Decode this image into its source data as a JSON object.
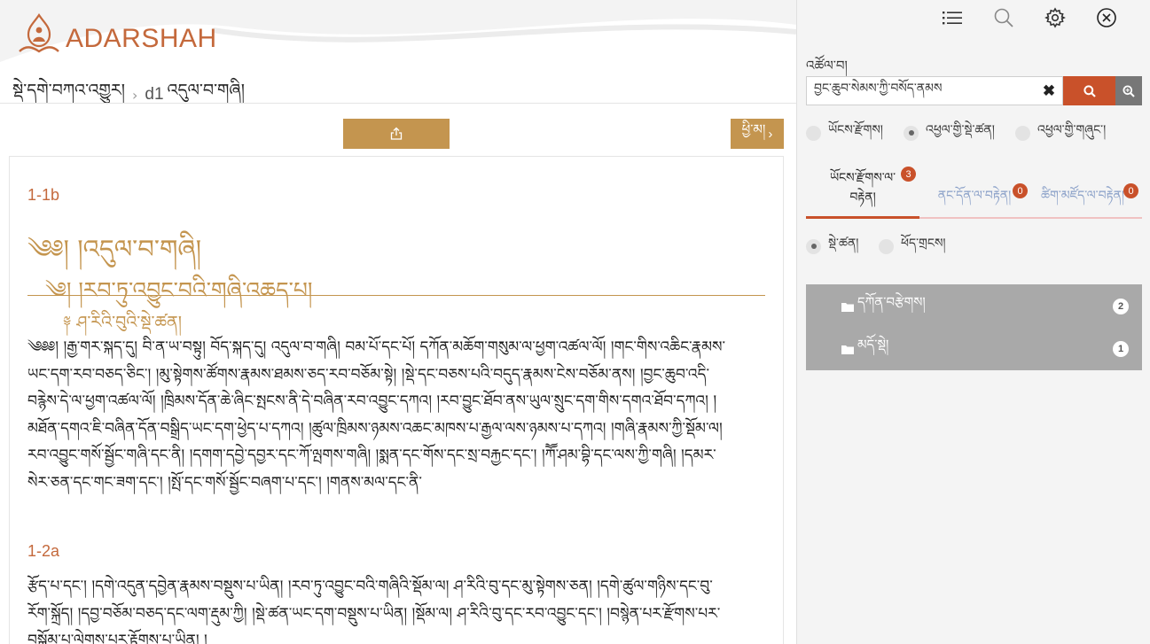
{
  "brand": {
    "name": "ADARSHAH",
    "color": "#c4693c"
  },
  "breadcrumb": {
    "collection": "སྡེ་དགེ་བཀའ་འགྱུར།",
    "separator": "›",
    "code": "d1",
    "title": "འདུལ་བ་གཞི།"
  },
  "toolbar": {
    "share_icon": "share-icon",
    "next_label": "ཕྱི་མ།",
    "next_chevron": "›"
  },
  "content": {
    "sections": [
      {
        "page_ref": "1-1b",
        "heading1": "༄༅། །འདུལ་བ་གཞི།",
        "heading2": "༄། །རབ་ཏུ་འབྱུང་བའི་གཞི་འཆད་པ།",
        "heading3": "༈ ཤ་རིའི་བུའི་སྡེ་ཚན།",
        "lines": [
          "༄༅༅། །རྒྱ་གར་སྐད་དུ། བི་ན་ཡ་བསྟུ། བོད་སྐད་དུ། འདུལ་བ་གཞི། བམ་པོ་དང་པོ། དཀོན་མཆོག་གསུམ་ལ་ཕྱག་འཚལ་ལོ། །གང་གིས་འཆིང་རྣམས་",
          "ཡང་དག་རབ་བཅད་ཅིང་། །མུ་སྟེགས་ཚོགས་རྣམས་ཐམས་ཅད་རབ་བཅོམ་སྟེ། །སྡེ་དང་བཅས་པའི་བདུད་རྣམས་ངེས་བཅོམ་ནས། །བྱང་ཆུབ་འདི་",
          "བརྙེས་དེ་ལ་ཕྱག་འཚལ་ལོ། །ཁྲིམས་དོན་ཆེ་ཞིང་སྤངས་ནི་དེ་བཞིན་རབ་འབྱུང་དཀའ། །རབ་བྱུང་ཐོབ་ནས་ཡུལ་སྲུང་དག་གིས་དགའ་ཐོབ་དཀའ། །",
          "མཐོན་དགའ་ཇི་བཞིན་དོན་བསྒྲིད་ཡང་དག་ཕྱེད་པ་དཀའ། །ཚུལ་ཁྲིམས་ཉམས་འཆང་མཁས་པ་རྒྱལ་ལས་ཉམས་པ་དཀའ། །གཞི་རྣམས་ཀྱི་སྡོམ་ལ།",
          "རབ་འབྱུང་གསོ་སྦྱོང་གཞི་དང་ནི། །དགག་དབྱེ་དབྱར་དང་ཀོ་ལྤགས་གཞི། །སྨན་དང་གོས་དང་སྲ་བརྐྱང་དང་། །ཀཽ་ཤམ་བྷི་དང་ལས་ཀྱི་གཞི། །དམར་",
          "སེར་ཅན་དང་གང་ཟག་དང་། །སྤོ་དང་གསོ་སྦྱོང་བཞག་པ་དང་། །གནས་མལ་དང་ནི་"
        ]
      },
      {
        "page_ref": "1-2a",
        "lines": [
          "རྩོད་པ་དང་། །དགེ་འདུན་དབྱེན་རྣམས་བསྡུས་པ་ཡིན། །རབ་ཏུ་འབྱུང་བའི་གཞིའི་སྡོམ་ལ། ཤ་རིའི་བུ་དང་མུ་སྟེགས་ཅན། །དགེ་ཚུལ་གཉིས་དང་བུ་",
          "རོག་སྐྲོད། །དབྱ་བཅོམ་བཅད་དང་ལག་རྡུམ་ཀྱི། །སྡེ་ཚན་ཡང་དག་བསྡུས་པ་ཡིན། །སྡོམ་ལ། ཤ་རིའི་བུ་དང་རབ་འབྱུང་དང་། །བསྙེན་པར་རྫོགས་པར་",
          "བསྒོམ་པ་ལེགས་པར་རྟོགས་པ་ཡིན། །"
        ]
      }
    ]
  },
  "panel": {
    "toolbar_icons": [
      "list-icon",
      "search-icon",
      "gear-icon",
      "close-circle-icon"
    ],
    "search": {
      "label": "འཚོལ་བ།",
      "value": "བྱང་ཆུབ་སེམས་ཀྱི་བསོད་ནམས",
      "placeholder": "",
      "clear_label": "✖",
      "search_icon": "search-icon",
      "advanced_icon": "advanced-search-icon"
    },
    "scope_options": [
      {
        "label": "ཡོངས་རྫོགས།",
        "selected": false
      },
      {
        "label": "འཕྱལ་གྱི་སྡེ་ཚན།",
        "selected": true
      },
      {
        "label": "འཕྱལ་གྱི་གཞུང་།",
        "selected": false
      }
    ],
    "tabs": [
      {
        "line1": "ཡོངས་རྫོགས་ལ་",
        "line2": "བརྟེན།",
        "count": "3",
        "active": true
      },
      {
        "line1": "ནང་དོན་ལ་བརྟེན།",
        "line2": "",
        "count": "0",
        "active": false
      },
      {
        "line1": "ཚིག་མཛོད་ལ་བརྟེན།",
        "line2": "",
        "count": "0",
        "active": false
      }
    ],
    "view_options": [
      {
        "label": "སྡེ་ཚན།",
        "selected": true
      },
      {
        "label": "ཕོད་གྲངས།",
        "selected": false
      }
    ],
    "results": [
      {
        "label": "དཀོན་བརྩེགས།",
        "count": "2"
      },
      {
        "label": "མདོ་སྡེ།",
        "count": "1"
      }
    ]
  },
  "colors": {
    "accent": "#c4954f",
    "accent_red": "#c9512a",
    "results_bg": "#a9a9a9",
    "inactive_tab": "#8aa0c8"
  }
}
